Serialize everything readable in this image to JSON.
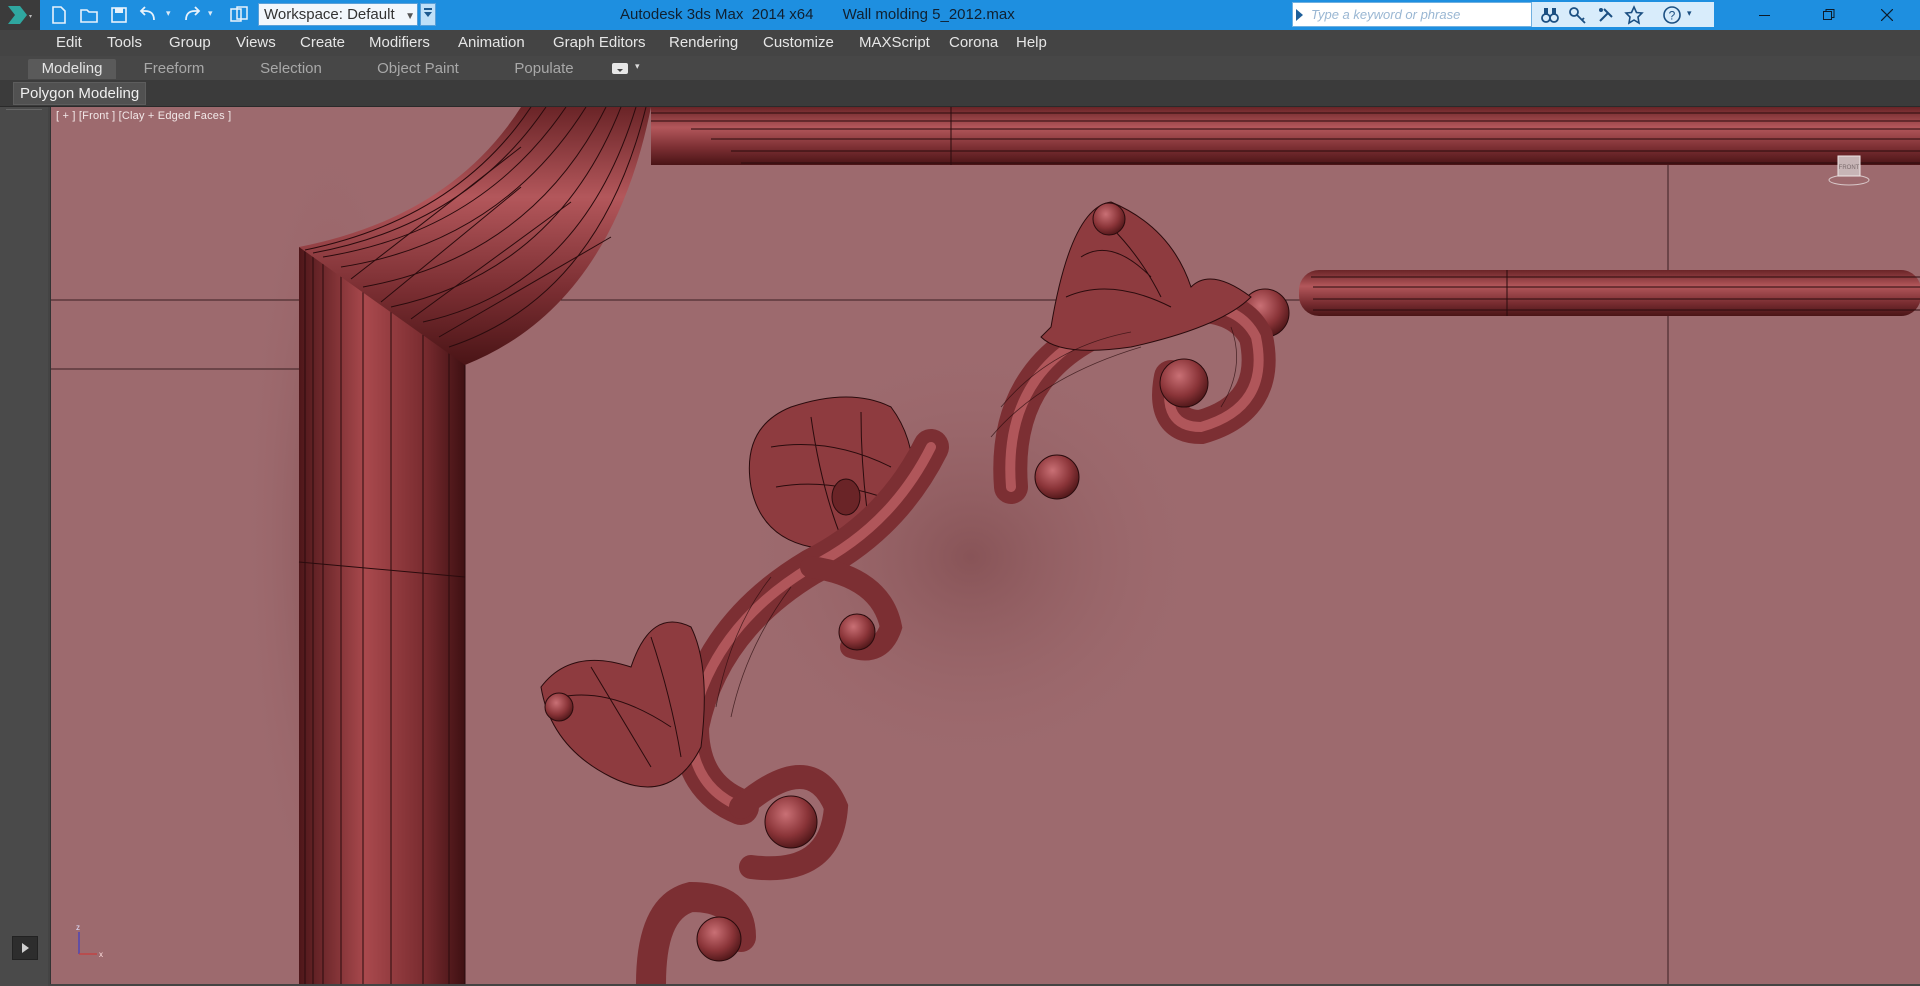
{
  "titlebar": {
    "app_title": "Autodesk 3ds Max  2014 x64",
    "file_name": "Wall molding 5_2012.max",
    "workspace_value": "Workspace: Default",
    "search_placeholder": "Type a keyword or phrase",
    "quick_access": [
      "new-icon",
      "open-icon",
      "save-icon",
      "undo-icon",
      "redo-icon",
      "project-icon"
    ],
    "info_icons": [
      "binoculars-icon",
      "key-icon",
      "star-tools-icon",
      "star-icon",
      "help-icon"
    ],
    "window_controls": [
      "minimize-icon",
      "restore-icon",
      "close-icon"
    ]
  },
  "menu": {
    "items": [
      "Edit",
      "Tools",
      "Group",
      "Views",
      "Create",
      "Modifiers",
      "Animation",
      "Graph Editors",
      "Rendering",
      "Customize",
      "MAXScript",
      "Corona",
      "Help"
    ]
  },
  "ribbon": {
    "tabs": [
      "Modeling",
      "Freeform",
      "Selection",
      "Object Paint",
      "Populate"
    ],
    "active_tab": "Modeling",
    "panel_label": "Polygon Modeling"
  },
  "viewport": {
    "label": "[ + ] [Front ] [Clay + Edged Faces ]",
    "viewcube_label": "FRONT",
    "background_color": "#9d6a6e",
    "model_color": "#8b3a3e",
    "wire_color": "#2a0b0d",
    "axis_labels": [
      "z",
      "x"
    ]
  }
}
